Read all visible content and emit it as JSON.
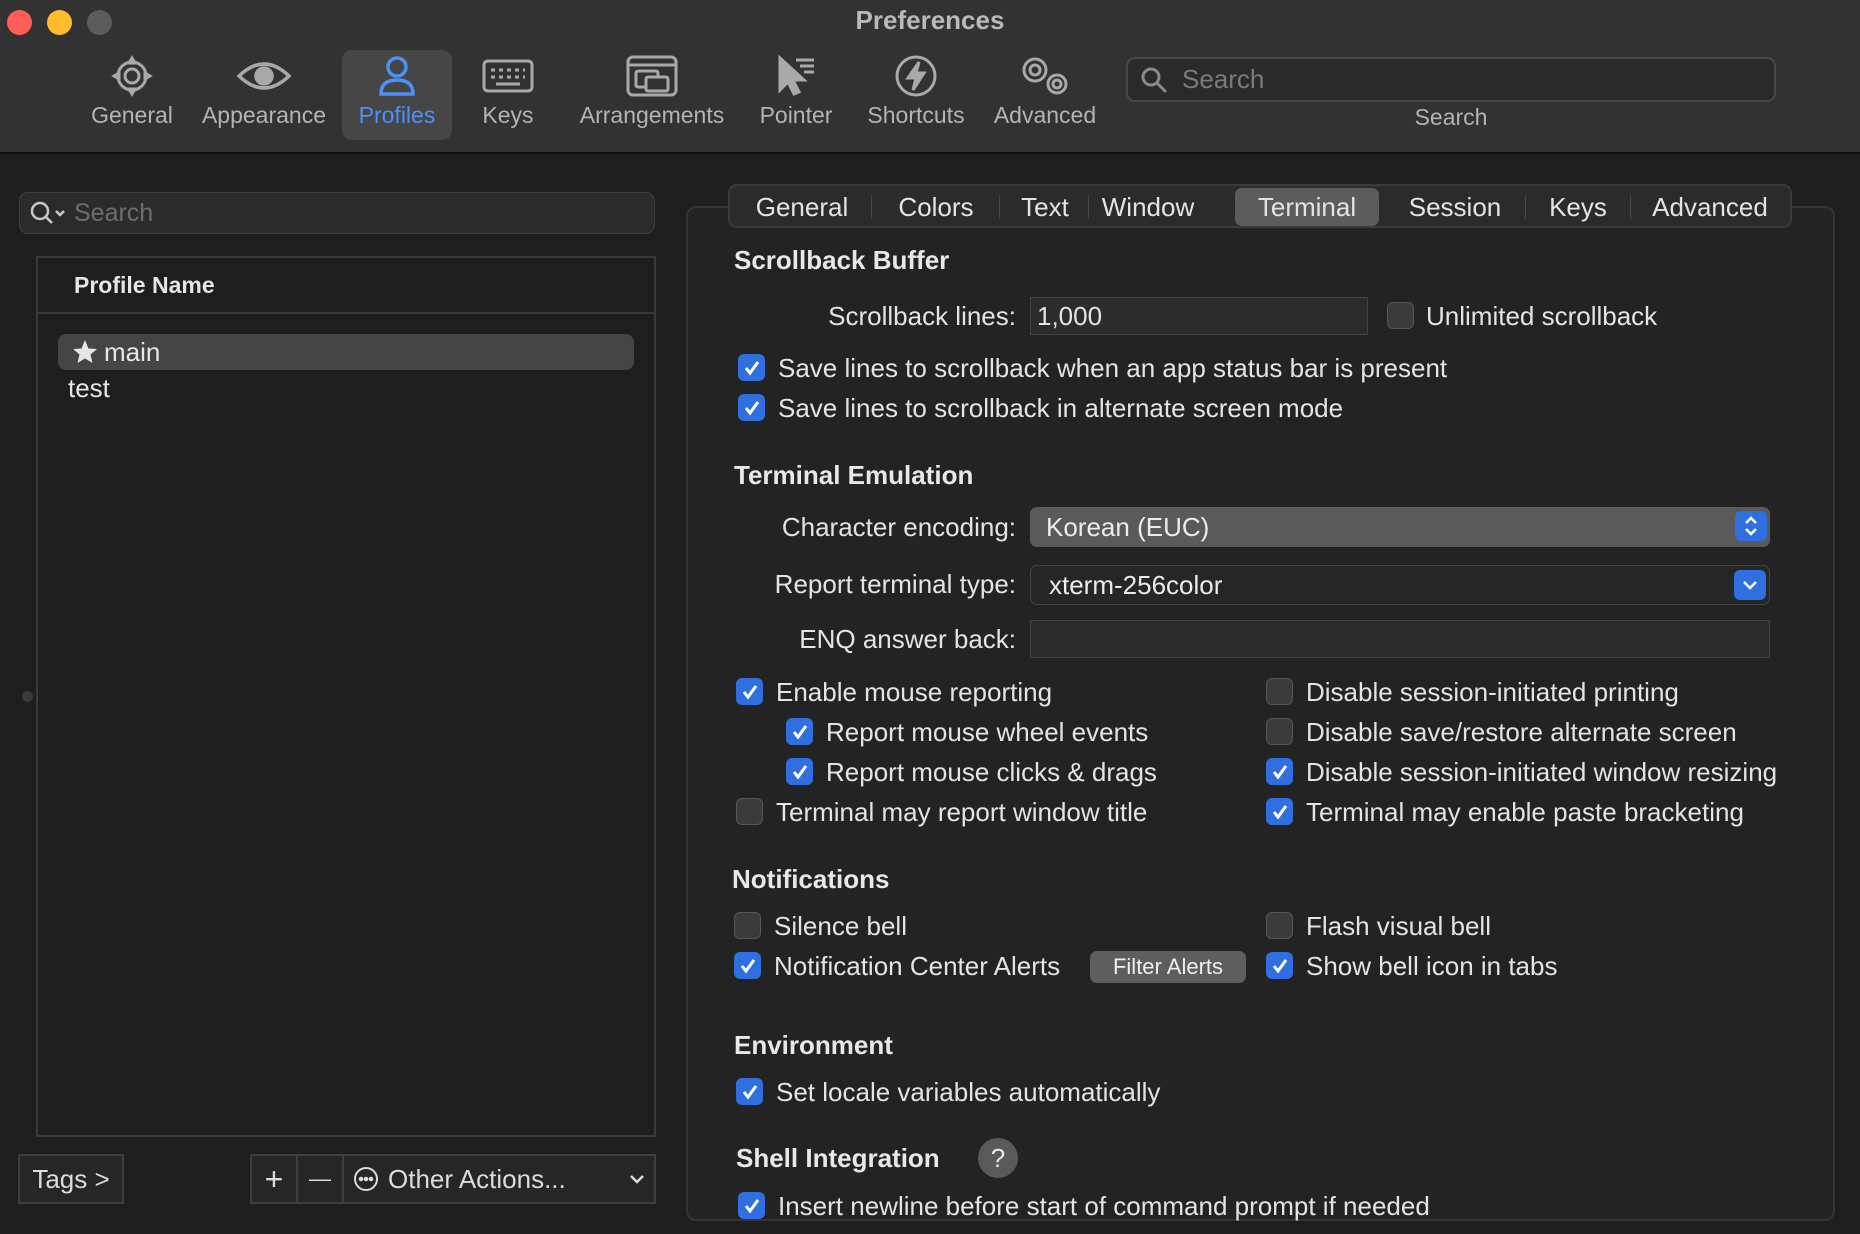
{
  "window": {
    "title": "Preferences",
    "traffic_colors": [
      "#ff5f57",
      "#febc2e",
      "#5c5c5c"
    ]
  },
  "toolbar": {
    "items": [
      {
        "label": "General",
        "icon": "gear-icon"
      },
      {
        "label": "Appearance",
        "icon": "eye-icon"
      },
      {
        "label": "Profiles",
        "icon": "person-icon",
        "selected": true
      },
      {
        "label": "Keys",
        "icon": "keyboard-icon"
      },
      {
        "label": "Arrangements",
        "icon": "windows-icon"
      },
      {
        "label": "Pointer",
        "icon": "pointer-icon"
      },
      {
        "label": "Shortcuts",
        "icon": "lightning-icon"
      },
      {
        "label": "Advanced",
        "icon": "gears-icon"
      }
    ],
    "search_placeholder": "Search",
    "search_caption": "Search"
  },
  "profiles": {
    "search_placeholder": "Search",
    "column_header": "Profile Name",
    "rows": [
      {
        "name": "main",
        "default": true,
        "selected": true
      },
      {
        "name": "test",
        "default": false,
        "selected": false
      }
    ],
    "tags_button": "Tags >",
    "add_button": "+",
    "remove_button": "—",
    "other_actions": "Other Actions..."
  },
  "tabs": [
    "General",
    "Colors",
    "Text",
    "Window",
    "Terminal",
    "Session",
    "Keys",
    "Advanced"
  ],
  "active_tab": "Terminal",
  "scrollback": {
    "title": "Scrollback Buffer",
    "lines_label": "Scrollback lines:",
    "lines_value": "1,000",
    "unlimited_label": "Unlimited scrollback",
    "unlimited_checked": false,
    "save_status_bar_label": "Save lines to scrollback when an app status bar is present",
    "save_status_bar_checked": true,
    "save_alternate_label": "Save lines to scrollback in alternate screen mode",
    "save_alternate_checked": true
  },
  "emulation": {
    "title": "Terminal Emulation",
    "encoding_label": "Character encoding:",
    "encoding_value": "Korean (EUC)",
    "terminal_type_label": "Report terminal type:",
    "terminal_type_value": "xterm-256color",
    "enq_label": "ENQ answer back:",
    "enq_value": "",
    "mouse_reporting": {
      "label": "Enable mouse reporting",
      "checked": true
    },
    "mouse_wheel": {
      "label": "Report mouse wheel events",
      "checked": true
    },
    "mouse_clicks": {
      "label": "Report mouse clicks & drags",
      "checked": true
    },
    "window_title": {
      "label": "Terminal may report window title",
      "checked": false
    },
    "disable_printing": {
      "label": "Disable session-initiated printing",
      "checked": false
    },
    "disable_alt_screen": {
      "label": "Disable save/restore alternate screen",
      "checked": false
    },
    "disable_resizing": {
      "label": "Disable session-initiated window resizing",
      "checked": true
    },
    "paste_bracketing": {
      "label": "Terminal may enable paste bracketing",
      "checked": true
    }
  },
  "notifications": {
    "title": "Notifications",
    "silence_bell": {
      "label": "Silence bell",
      "checked": false
    },
    "notification_center": {
      "label": "Notification Center Alerts",
      "checked": true
    },
    "filter_alerts_button": "Filter Alerts",
    "flash_visual_bell": {
      "label": "Flash visual bell",
      "checked": false
    },
    "bell_icon_tabs": {
      "label": "Show bell icon in tabs",
      "checked": true
    }
  },
  "environment": {
    "title": "Environment",
    "locale": {
      "label": "Set locale variables automatically",
      "checked": true
    }
  },
  "shell_integration": {
    "title": "Shell Integration",
    "help": "?",
    "insert_newline": {
      "label": "Insert newline before start of command prompt if needed",
      "checked": true
    }
  },
  "colors": {
    "accent": "#2f6fe0",
    "selected_toolbar_label": "#4b91f7"
  }
}
